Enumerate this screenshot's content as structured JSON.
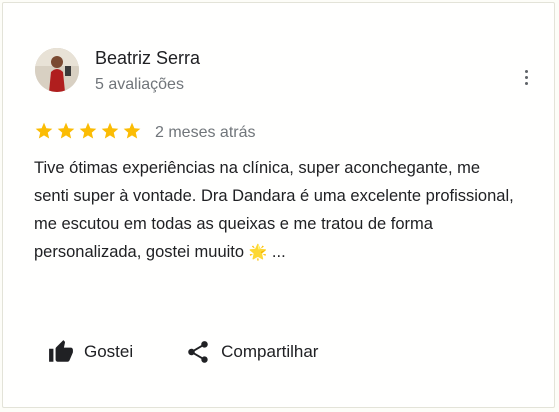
{
  "review": {
    "author": "Beatriz Serra",
    "review_count": "5 avaliações",
    "rating": 5,
    "rating_max": 5,
    "date": "2 meses atrás",
    "text_before_emoji": "Tive ótimas experiências na clínica, super aconchegante, me senti super à vontade. Dra Dandara é uma excelente profissional, me escutou em todas as queixas e me tratou de forma personalizada, gostei muuito ",
    "emoji": "🌟",
    "ellipsis": " ..."
  },
  "actions": {
    "like_label": "Gostei",
    "share_label": "Compartilhar"
  },
  "colors": {
    "star": "#fbbc04",
    "secondary_text": "#70757a",
    "icon": "#202124"
  },
  "icons": {
    "more": "more-vert-icon",
    "like": "thumb-up-icon",
    "share": "share-icon"
  }
}
